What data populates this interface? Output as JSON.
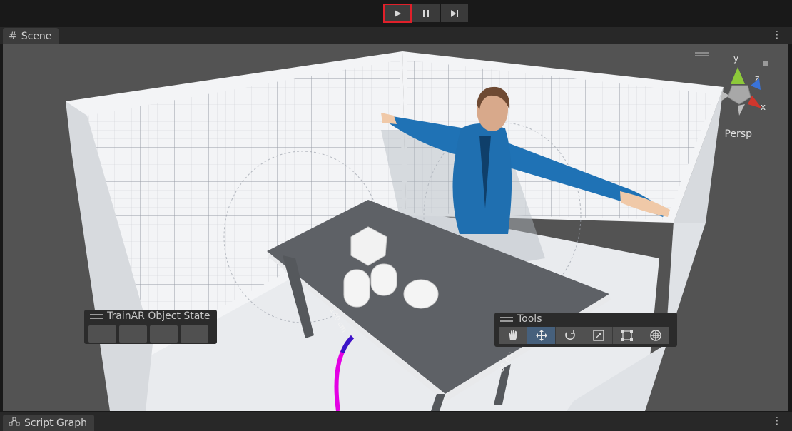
{
  "toolbar": {
    "play_icon": "play-icon",
    "pause_icon": "pause-icon",
    "step_icon": "step-icon",
    "highlight_color": "#e0202a"
  },
  "scene_tab": {
    "label": "Scene",
    "icon": "grid-icon"
  },
  "viewport": {
    "perspective_label": "Persp",
    "gizmo_axes": [
      "y",
      "z",
      "x"
    ],
    "axis_colors": {
      "x": "#d0372d",
      "y": "#8dc93a",
      "z": "#3a73d8"
    },
    "ruler_labels": [
      "140 cm",
      "80 cm"
    ]
  },
  "object_state_panel": {
    "title": "TrainAR Object State",
    "slots": 4
  },
  "tools_panel": {
    "title": "Tools",
    "tools": [
      "hand-icon",
      "move-icon",
      "rotate-icon",
      "scale-icon",
      "rect-icon",
      "transform-icon"
    ],
    "active_tool": "move-icon"
  },
  "bottom_tab": {
    "label": "Script Graph",
    "icon": "script-graph-icon"
  }
}
